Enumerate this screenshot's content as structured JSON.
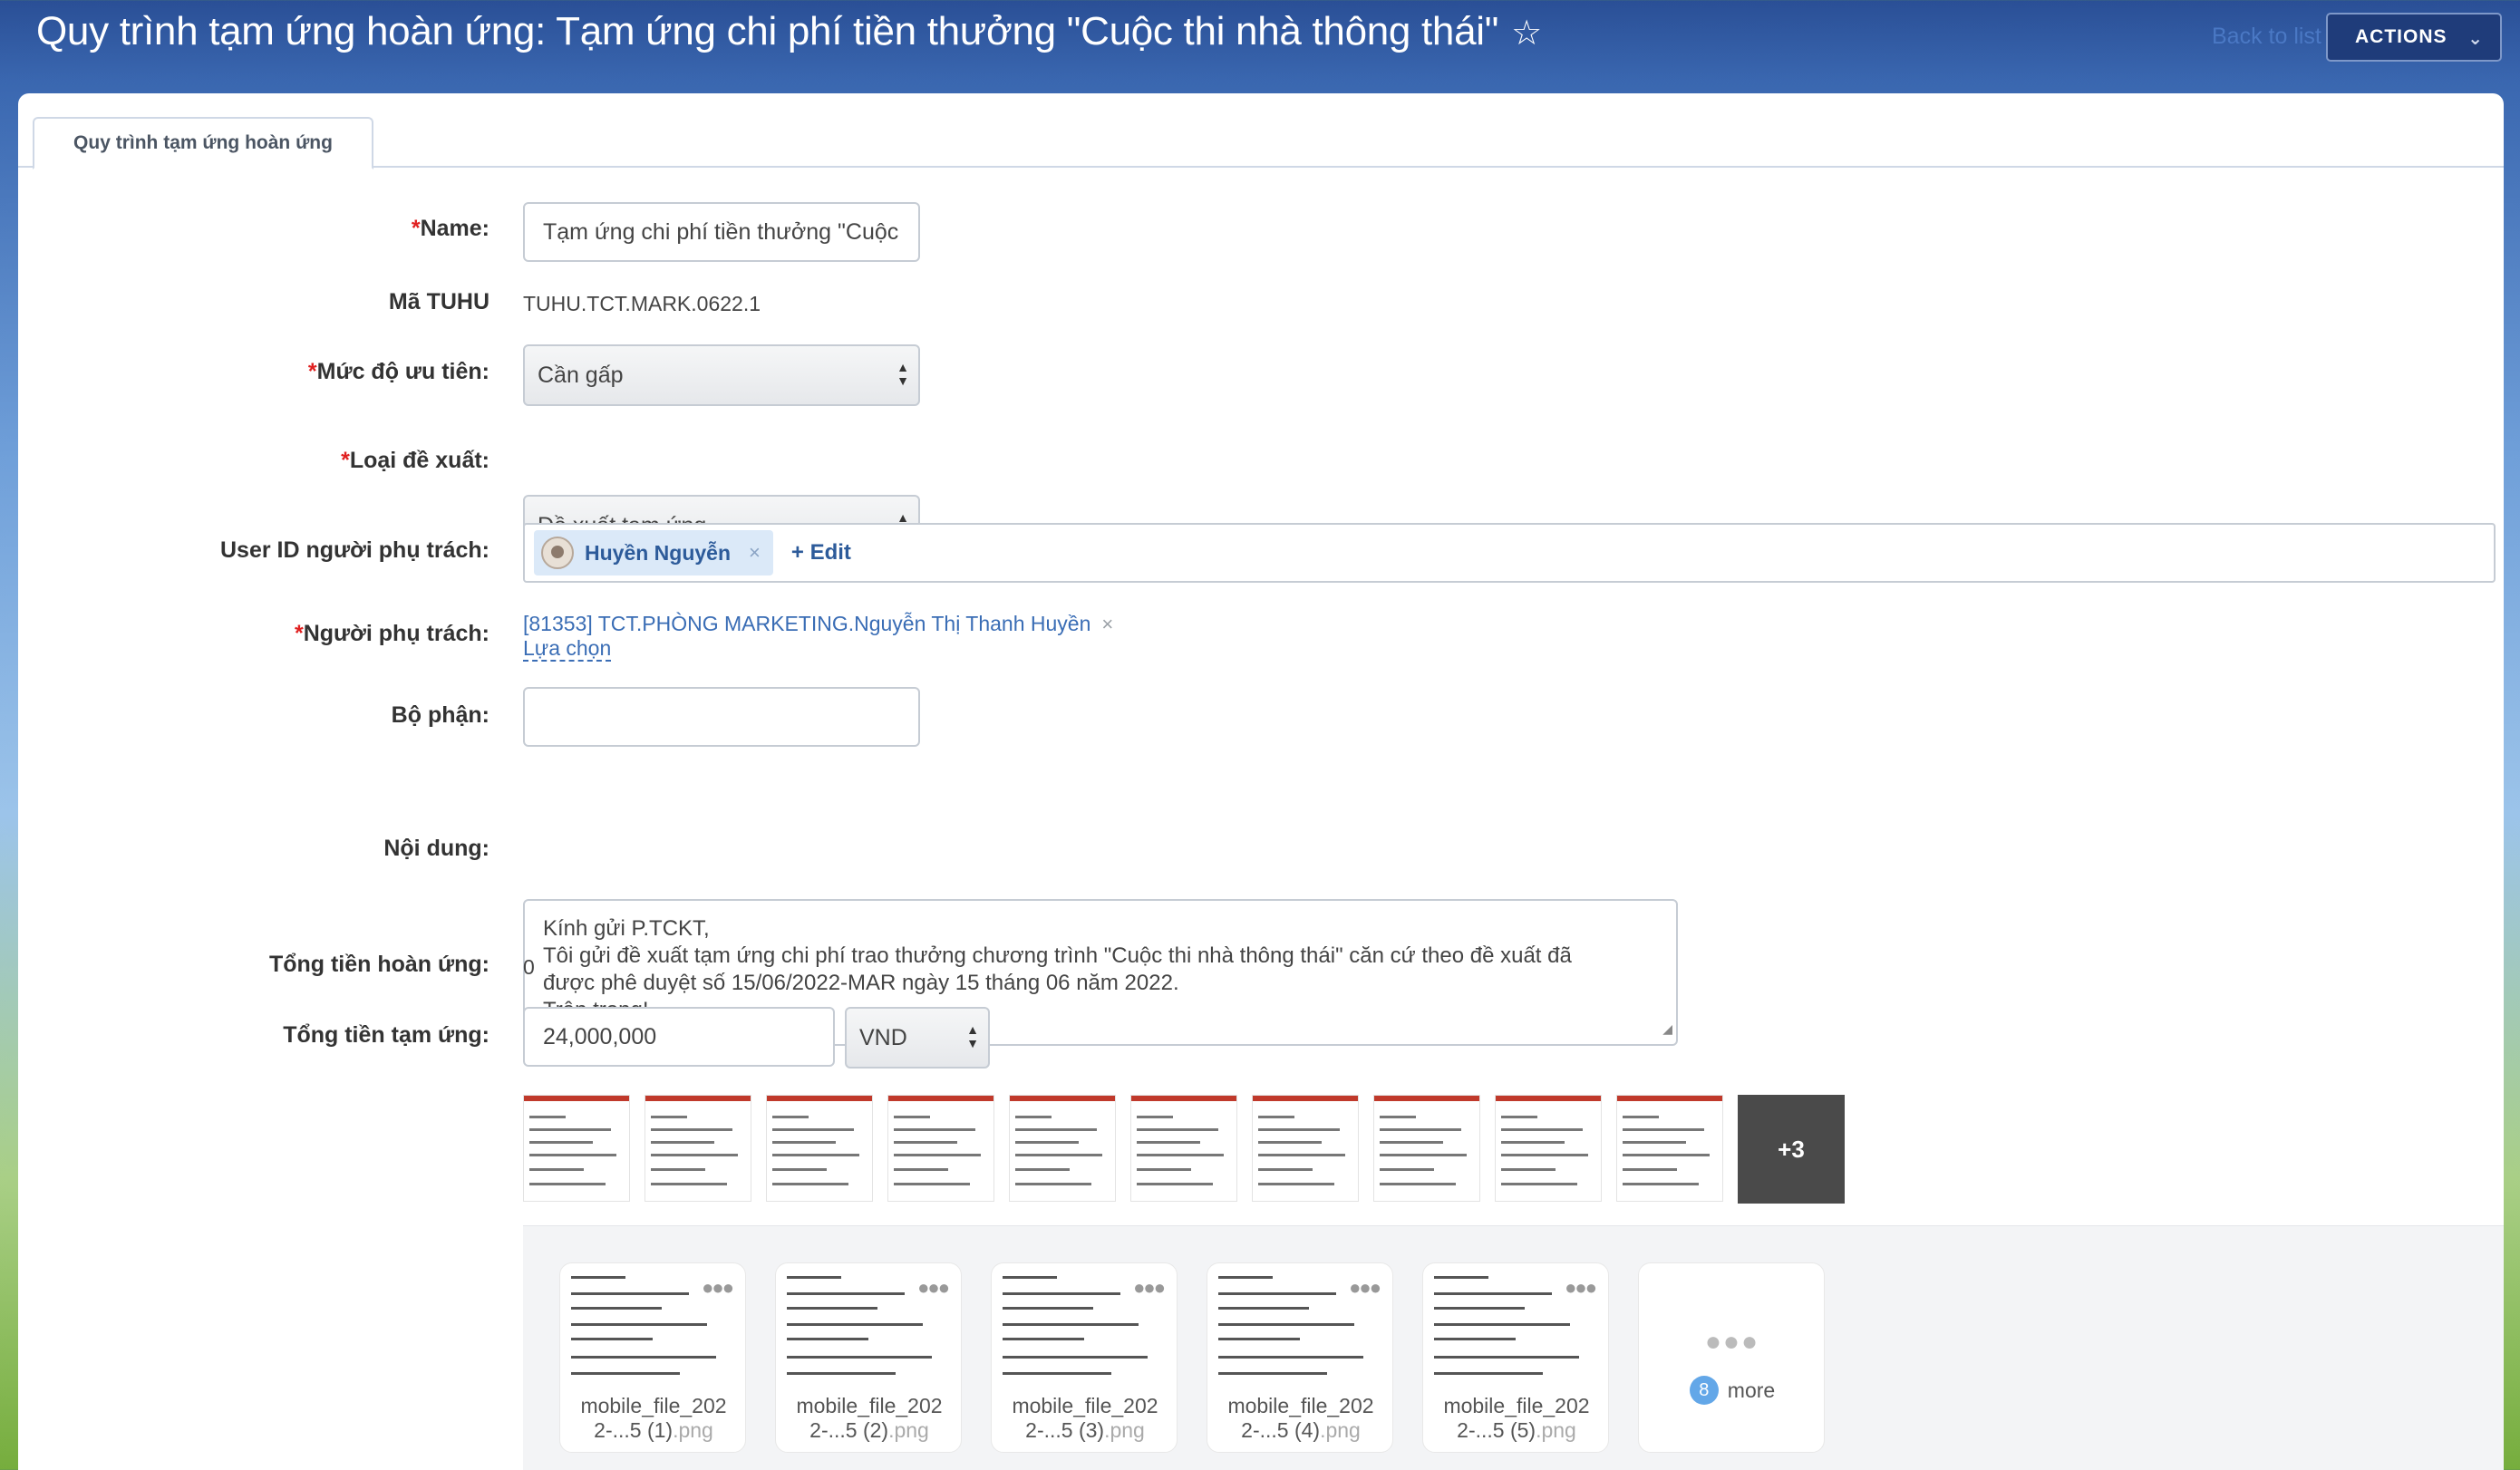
{
  "header": {
    "title": "Quy trình tạm ứng hoàn ứng: Tạm ứng chi phí tiền thưởng \"Cuộc thi nhà thông thái\"",
    "back_label": "Back to list",
    "actions_label": "ACTIONS"
  },
  "tabs": [
    {
      "label": "Quy trình tạm ứng hoàn ứng"
    }
  ],
  "form": {
    "name": {
      "label": "Name:",
      "value": "Tạm ứng chi phí tiền thưởng  \"Cuộc"
    },
    "code": {
      "label": "Mã TUHU",
      "value": "TUHU.TCT.MARK.0622.1"
    },
    "priority": {
      "label": "Mức độ ưu tiên:",
      "value": "Cần gấp"
    },
    "proposal_type": {
      "label": "Loại đề xuất:",
      "value": "Đề xuất tạm ứng"
    },
    "user_id": {
      "label": "User ID người phụ trách:",
      "user": "Huyền Nguyễn",
      "edit_label": "+ Edit"
    },
    "owner": {
      "label": "Người phụ trách:",
      "value": "[81353] TCT.PHÒNG MARKETING.Nguyễn Thị Thanh Huyền",
      "select_label": "Lựa chọn"
    },
    "department": {
      "label": "Bộ phận:",
      "value": ""
    },
    "content": {
      "label": "Nội dung:",
      "lines": [
        "Kính gửi P.TCKT,",
        "Tôi gửi đề xuất tạm ứng chi phí trao thưởng chương trình \"Cuộc thi nhà thông thái\" căn cứ theo đề xuất đã",
        "được phê duyệt số 15/06/2022-MAR ngày 15 tháng 06 năm 2022.",
        "Trân trọng!"
      ]
    },
    "refund_total": {
      "label": "Tổng tiền hoàn ứng:",
      "value": "0"
    },
    "advance_total": {
      "label": "Tổng tiền tạm ứng:",
      "value": "24,000,000",
      "currency": "VND"
    }
  },
  "thumbnails": {
    "count": 10,
    "more_label": "+3"
  },
  "files": [
    {
      "name_line1": "mobile_file_202",
      "name_line2": "2-...5 (1)",
      "ext": ".png"
    },
    {
      "name_line1": "mobile_file_202",
      "name_line2": "2-...5 (2)",
      "ext": ".png"
    },
    {
      "name_line1": "mobile_file_202",
      "name_line2": "2-...5 (3)",
      "ext": ".png"
    },
    {
      "name_line1": "mobile_file_202",
      "name_line2": "2-...5 (4)",
      "ext": ".png"
    },
    {
      "name_line1": "mobile_file_202",
      "name_line2": "2-...5 (5)",
      "ext": ".png"
    }
  ],
  "files_more": {
    "count": "8",
    "label": "more"
  }
}
